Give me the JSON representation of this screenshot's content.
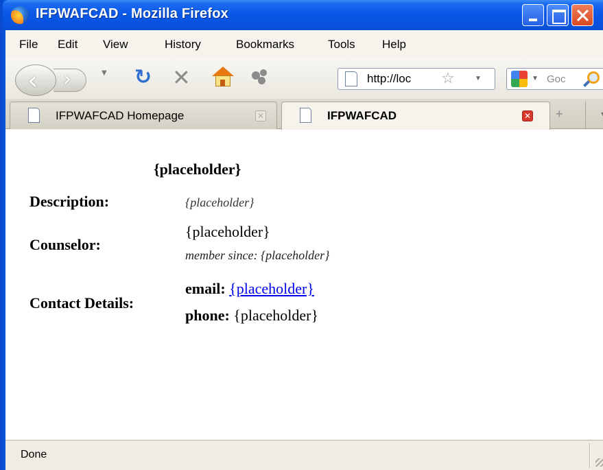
{
  "window": {
    "title": "IFPWAFCAD - Mozilla Firefox"
  },
  "menu": {
    "items": [
      {
        "label": "File"
      },
      {
        "label": "Edit"
      },
      {
        "label": "View"
      },
      {
        "label": "History"
      },
      {
        "label": "Bookmarks"
      },
      {
        "label": "Tools"
      },
      {
        "label": "Help"
      }
    ]
  },
  "navbar": {
    "url": "http://loc",
    "search_placeholder": "Goc"
  },
  "tabs": [
    {
      "label": "IFPWAFCAD Homepage",
      "active": false
    },
    {
      "label": "IFPWAFCAD",
      "active": true
    }
  ],
  "page": {
    "heading": "{placeholder}",
    "description": {
      "label": "Description:",
      "value": "{placeholder}"
    },
    "counselor": {
      "label": "Counselor:",
      "name": "{placeholder}",
      "member_since": "member since: {placeholder}"
    },
    "contact": {
      "label": "Contact Details:",
      "email_label": "email:",
      "email_value": "{placeholder}",
      "phone_label": "phone:",
      "phone_value": "{placeholder}"
    }
  },
  "status": {
    "text": "Done"
  },
  "colors": {
    "titlebar": "#0a58e6",
    "link": "#0000ee",
    "active_tab_close": "#d8372b"
  }
}
